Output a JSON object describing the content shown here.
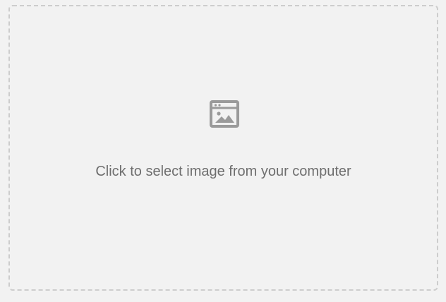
{
  "dropzone": {
    "prompt": "Click to select image from your computer",
    "icon": "image-window-icon"
  },
  "colors": {
    "background": "#f2f2f2",
    "border": "#cdcdcd",
    "icon": "#9a9a9a",
    "text": "#6e6e6e"
  }
}
